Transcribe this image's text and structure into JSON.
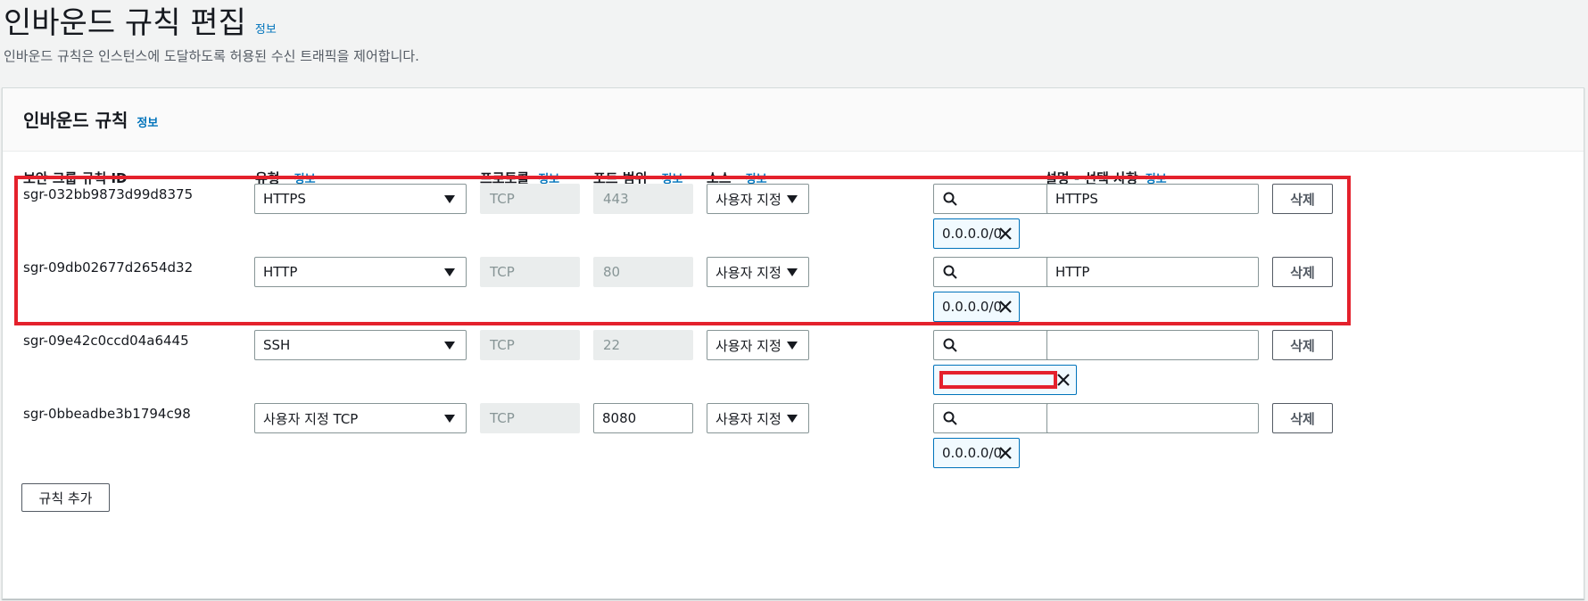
{
  "page": {
    "title": "인바운드 규칙 편집",
    "title_info": "정보",
    "description": "인바운드 규칙은 인스턴스에 도달하도록 허용된 수신 트래픽을 제어합니다."
  },
  "panel": {
    "title": "인바운드 규칙",
    "title_info": "정보"
  },
  "columns": {
    "rule_id": "보안 그룹 규칙 ID",
    "type": "유형",
    "type_info": "정보",
    "protocol": "프로토콜",
    "protocol_info": "정보",
    "port_range": "포트 범위",
    "port_range_info": "정보",
    "source": "소스",
    "source_info": "정보",
    "description": "설명 - 선택 사항",
    "description_info": "정보"
  },
  "rules": [
    {
      "id": "sgr-032bb9873d99d8375",
      "type": "HTTPS",
      "protocol": "TCP",
      "port": "443",
      "source_type": "사용자 지정",
      "cidr": "0.0.0.0/0",
      "description": "HTTPS",
      "delete_label": "삭제"
    },
    {
      "id": "sgr-09db02677d2654d32",
      "type": "HTTP",
      "protocol": "TCP",
      "port": "80",
      "source_type": "사용자 지정",
      "cidr": "0.0.0.0/0",
      "description": "HTTP",
      "delete_label": "삭제"
    },
    {
      "id": "sgr-09e42c0ccd04a6445",
      "type": "SSH",
      "protocol": "TCP",
      "port": "22",
      "source_type": "사용자 지정",
      "cidr": "",
      "description": "",
      "delete_label": "삭제"
    },
    {
      "id": "sgr-0bbeadbe3b1794c98",
      "type": "사용자 지정 TCP",
      "protocol": "TCP",
      "port": "8080",
      "source_type": "사용자 지정",
      "cidr": "0.0.0.0/0",
      "description": "",
      "delete_label": "삭제"
    }
  ],
  "add_rule_label": "규칙 추가",
  "colors": {
    "link": "#0073bb",
    "highlight": "#e4212c",
    "token_border": "#0073bb",
    "token_bg": "#f1faff"
  }
}
